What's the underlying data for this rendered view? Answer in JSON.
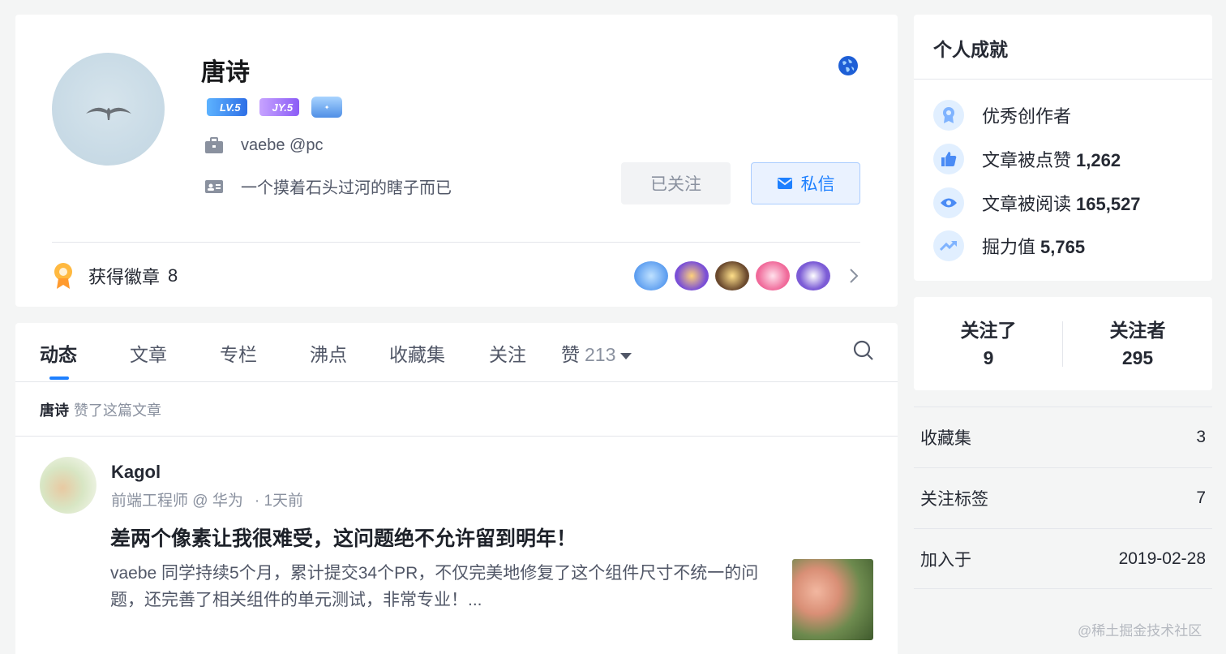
{
  "profile": {
    "name": "唐诗",
    "level_badge": "LV.5",
    "jy_badge": "JY.5",
    "job": "vaebe @pc",
    "bio": "一个摸着石头过河的瞎子而已",
    "followed_label": "已关注",
    "message_label": "私信",
    "badges_label": "获得徽章",
    "badges_count": "8"
  },
  "tabs": [
    {
      "label": "动态"
    },
    {
      "label": "文章"
    },
    {
      "label": "专栏"
    },
    {
      "label": "沸点"
    },
    {
      "label": "收藏集"
    },
    {
      "label": "关注"
    },
    {
      "label": "赞",
      "count": "213"
    }
  ],
  "activity": {
    "who": "唐诗",
    "what": "赞了这篇文章"
  },
  "post": {
    "author": "Kagol",
    "role": "前端工程师 @ 华为",
    "time": "· 1天前",
    "title": "差两个像素让我很难受，这问题绝不允许留到明年！",
    "excerpt": "vaebe 同学持续5个月，累计提交34个PR，不仅完美地修复了这个组件尺寸不统一的问题，还完善了相关组件的单元测试，非常专业！..."
  },
  "achievements": {
    "title": "个人成就",
    "items": [
      {
        "label": "优秀创作者",
        "value": ""
      },
      {
        "label": "文章被点赞",
        "value": "1,262"
      },
      {
        "label": "文章被阅读",
        "value": "165,527"
      },
      {
        "label": "掘力值",
        "value": "5,765"
      }
    ]
  },
  "follow": {
    "following_label": "关注了",
    "following_value": "9",
    "followers_label": "关注者",
    "followers_value": "295"
  },
  "stats": [
    {
      "label": "收藏集",
      "value": "3"
    },
    {
      "label": "关注标签",
      "value": "7"
    },
    {
      "label": "加入于",
      "value": "2019-02-28"
    }
  ],
  "watermark": "@稀土掘金技术社区",
  "colors": {
    "accent": "#1e80ff",
    "muted": "#8a919f",
    "text": "#252933"
  }
}
